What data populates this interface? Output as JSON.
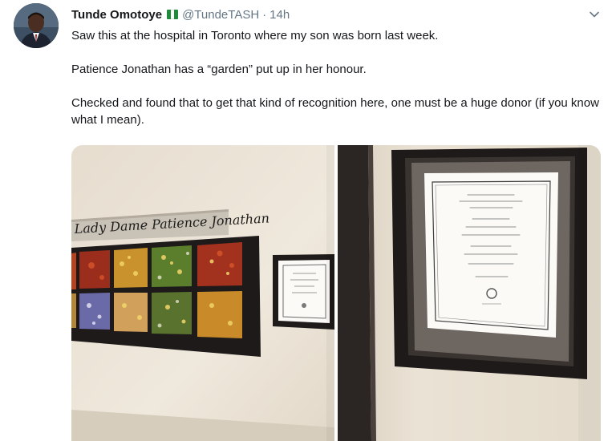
{
  "tweet": {
    "author_name": "Tunde Omotoye",
    "author_handle": "@TundeTASH",
    "separator": "·",
    "timestamp": "14h",
    "flag_colors": [
      "#1f8a3b",
      "#ffffff",
      "#1f8a3b"
    ],
    "paragraphs": [
      "Saw this at the hospital in Toronto where my son was born last week.",
      "Patience Jonathan has a “garden” put up in her honour.",
      "Checked and found that to get that kind of recognition here, one must be a huge donor (if you know what I mean)."
    ],
    "photo_left": {
      "plaque_text": "Lady Dame Patience Jonathan"
    }
  },
  "colors": {
    "text_primary": "#14171a",
    "text_secondary": "#657786",
    "wall": "#ece4d6",
    "frame": "#1f1b1a"
  },
  "icons": {
    "more_menu": "chevron-down-icon",
    "country": "nigeria-flag-icon"
  }
}
